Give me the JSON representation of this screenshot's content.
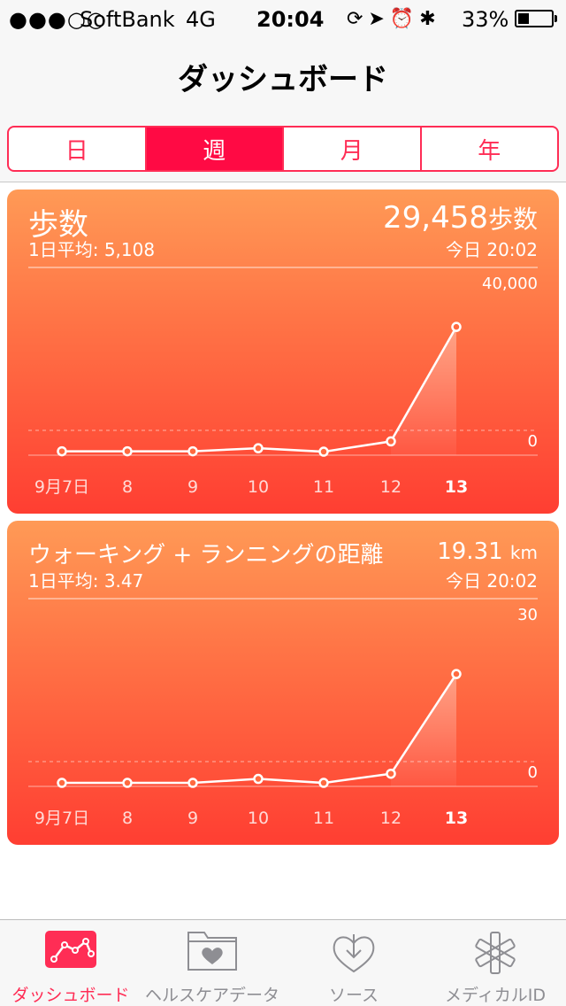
{
  "status_bar": {
    "signal": "●●●○○",
    "carrier": "SoftBank",
    "network": "4G",
    "time": "20:04",
    "icons": "⟳➤⏰✱",
    "battery_text": "33%",
    "battery_level": 0.33
  },
  "nav": {
    "title": "ダッシュボード"
  },
  "segments": [
    {
      "label": "日",
      "active": false
    },
    {
      "label": "週",
      "active": true
    },
    {
      "label": "月",
      "active": false
    },
    {
      "label": "年",
      "active": false
    }
  ],
  "cards": [
    {
      "title": "歩数",
      "subtitle": "1日平均: 5,108",
      "value": "29,458",
      "unit": "歩数",
      "time": "今日 20:02"
    },
    {
      "title": "ウォーキング + ランニングの距離",
      "subtitle": "1日平均: 3.47",
      "value": "19.31",
      "unit": "km",
      "time": "今日 20:02"
    }
  ],
  "chart_data": [
    {
      "type": "line",
      "categories": [
        "9月7日",
        "8",
        "9",
        "10",
        "11",
        "12",
        "13"
      ],
      "values": [
        500,
        500,
        500,
        1200,
        400,
        2800,
        29458
      ],
      "ylim": [
        0,
        40000
      ],
      "ytick_labels": [
        "40,000",
        "0"
      ],
      "highlight_category": "13"
    },
    {
      "type": "line",
      "categories": [
        "9月7日",
        "8",
        "9",
        "10",
        "11",
        "12",
        "13"
      ],
      "values": [
        0.3,
        0.3,
        0.3,
        1.0,
        0.3,
        1.9,
        19.31
      ],
      "ylim": [
        0,
        30
      ],
      "ytick_labels": [
        "30",
        "0"
      ],
      "highlight_category": "13"
    }
  ],
  "tabs": [
    {
      "label": "ダッシュボード",
      "icon": "dashboard-chart-icon",
      "active": true
    },
    {
      "label": "ヘルスケアデータ",
      "icon": "health-data-folder-icon",
      "active": false
    },
    {
      "label": "ソース",
      "icon": "sources-download-heart-icon",
      "active": false
    },
    {
      "label": "メディカルID",
      "icon": "medical-id-asterisk-icon",
      "active": false
    }
  ],
  "colors": {
    "accent": "#ff2d55",
    "segment_active": "#ff0a44",
    "card_top": "#ff9a56",
    "card_bottom": "#ff3e32",
    "tab_inactive": "#8e8e93"
  }
}
